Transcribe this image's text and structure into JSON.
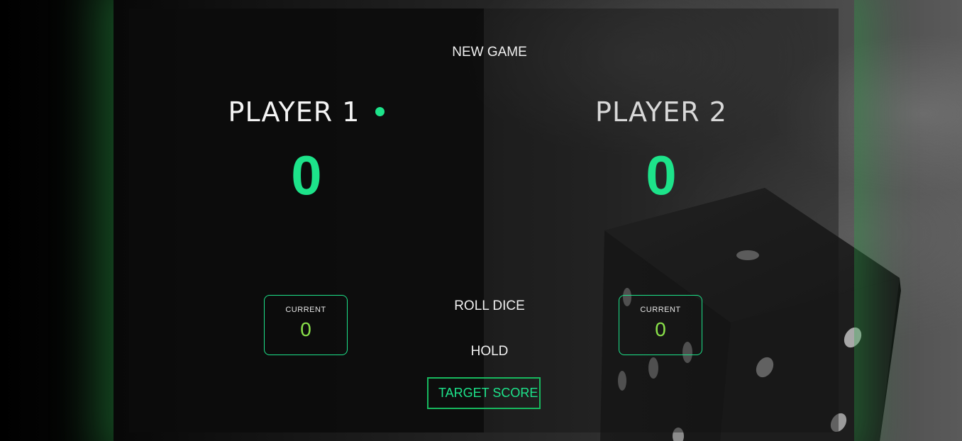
{
  "buttons": {
    "new_game": "NEW GAME",
    "roll_dice": "ROLL DICE",
    "hold": "HOLD",
    "target_score": "TARGET SCORE"
  },
  "players": [
    {
      "name": "PLAYER 1",
      "score": "0",
      "current_label": "CURRENT",
      "current_score": "0",
      "active": true
    },
    {
      "name": "PLAYER 2",
      "score": "0",
      "current_label": "CURRENT",
      "current_score": "0",
      "active": false
    }
  ],
  "colors": {
    "accent": "#1de38a",
    "current_score": "#8ae24a",
    "target_border": "#17b85e"
  },
  "icons": {
    "active_player_indicator": "active-player-dot-icon",
    "background": "dice-icon"
  }
}
